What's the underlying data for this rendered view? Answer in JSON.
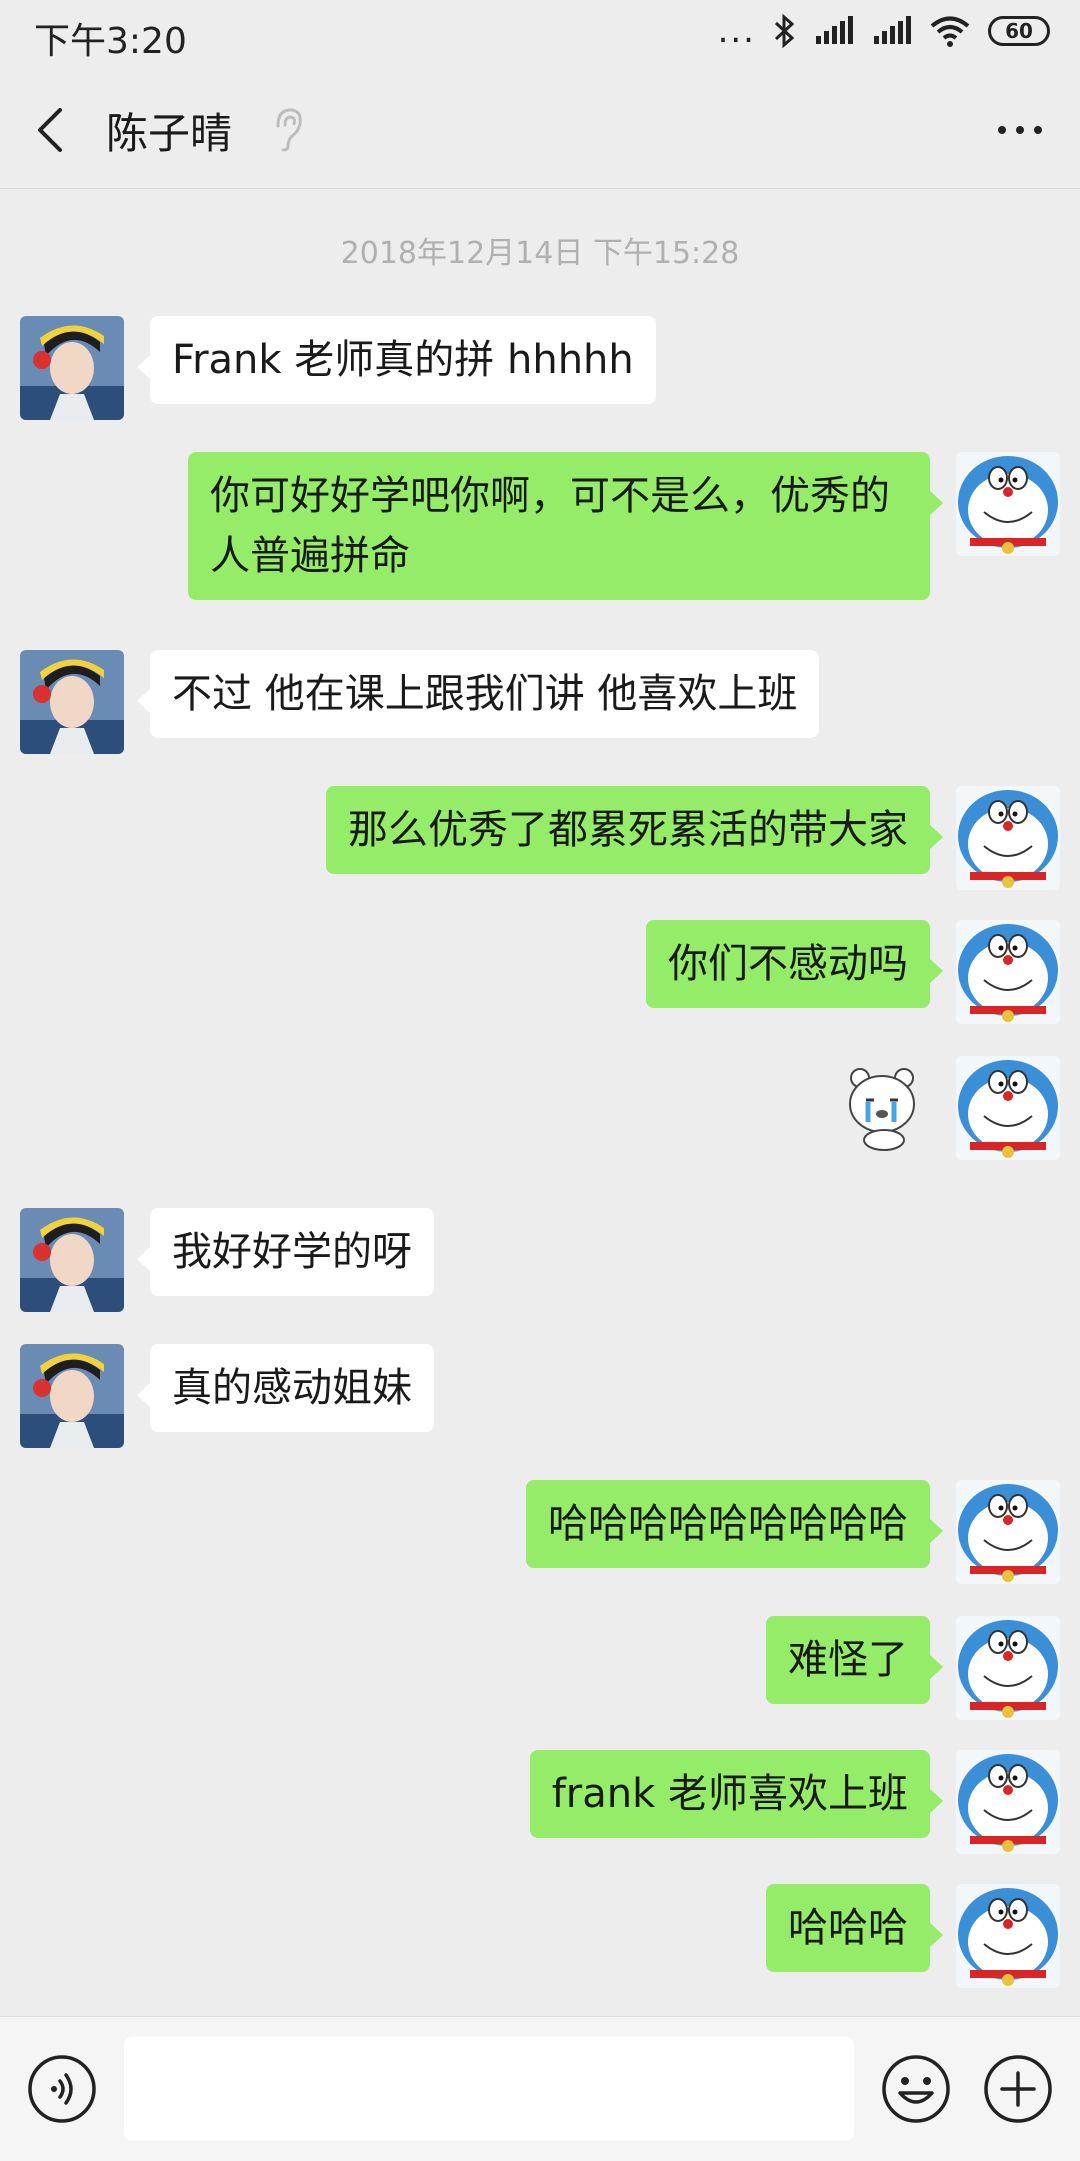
{
  "status_bar": {
    "time": "下午3:20",
    "battery": "60",
    "more": "..."
  },
  "header": {
    "title": "陈子晴"
  },
  "timestamp": "2018年12月14日 下午15:28",
  "messages": [
    {
      "side": "left",
      "text": "Frank 老师真的拼 hhhhh"
    },
    {
      "side": "right",
      "text": "你可好好学吧你啊，可不是么，优秀的人普遍拼命"
    },
    {
      "side": "left",
      "text": "不过 他在课上跟我们讲 他喜欢上班"
    },
    {
      "side": "right",
      "text": "那么优秀了都累死累活的带大家"
    },
    {
      "side": "right",
      "text": "你们不感动吗"
    },
    {
      "side": "right",
      "sticker": "crying-bear-sticker"
    },
    {
      "side": "left",
      "text": "我好好学的呀"
    },
    {
      "side": "left",
      "text": "真的感动姐妹"
    },
    {
      "side": "right",
      "text": "哈哈哈哈哈哈哈哈哈"
    },
    {
      "side": "right",
      "text": "难怪了"
    },
    {
      "side": "right",
      "text": "frank 老师喜欢上班"
    },
    {
      "side": "right",
      "text": "哈哈哈"
    }
  ],
  "input": {
    "value": ""
  },
  "colors": {
    "background": "#ededed",
    "bubble_self": "#95ec69",
    "bubble_other": "#ffffff"
  },
  "icons": [
    "back-arrow-icon",
    "ear-icon",
    "more-icon",
    "voice-icon",
    "emoji-icon",
    "plus-icon",
    "bluetooth-icon",
    "signal-icon",
    "wifi-icon",
    "battery-icon"
  ]
}
